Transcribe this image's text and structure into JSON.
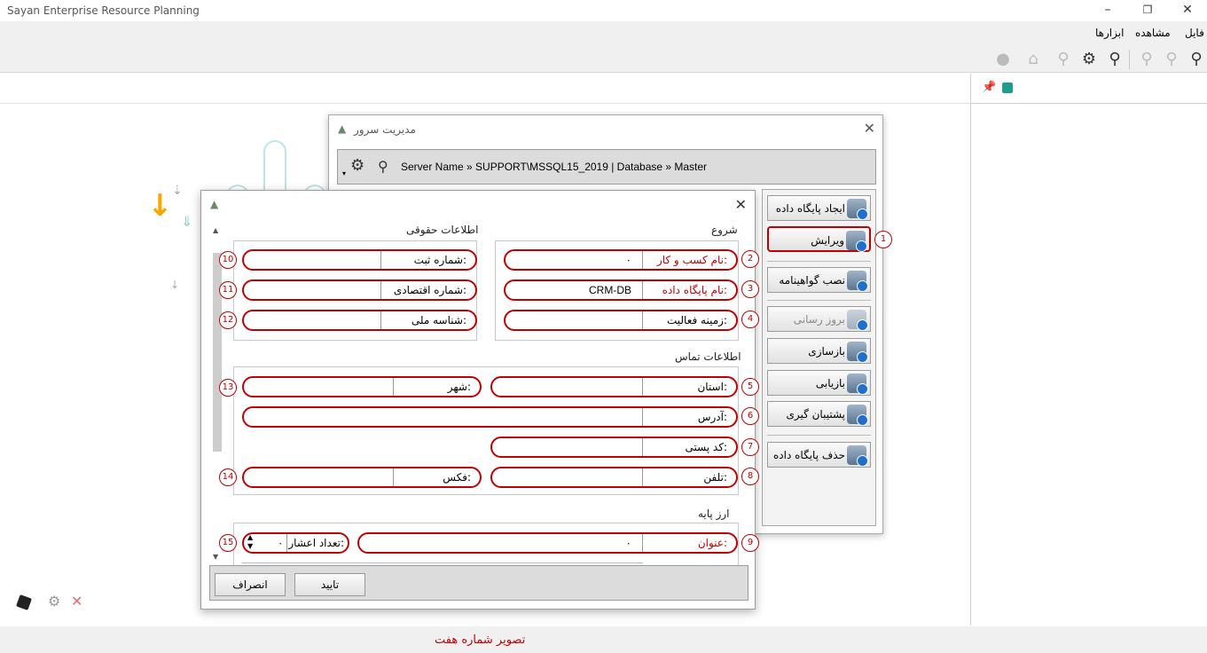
{
  "window": {
    "title": "Sayan Enterprise Resource Planning",
    "minimize_icon": "minimize-icon",
    "restore_icon": "restore-icon",
    "close_icon": "close-icon"
  },
  "menu": {
    "file": "فایل",
    "view": "مشاهده",
    "tools": "ابزارها"
  },
  "server_window": {
    "title": "مدیریت سرور",
    "connection": "Server Name » SUPPORT\\MSSQL15_2019 | Database » Master",
    "buttons": [
      {
        "label": "ایجاد پایگاه داده",
        "badge": ""
      },
      {
        "label": "ویرایش",
        "badge": "1"
      },
      {
        "label": "نصب گواهینامه",
        "badge": ""
      },
      {
        "label": "بروز رسانی",
        "badge": ""
      },
      {
        "label": "بازسازی",
        "badge": ""
      },
      {
        "label": "بازیابی",
        "badge": ""
      },
      {
        "label": "پشتیبان گیری",
        "badge": ""
      },
      {
        "label": "حذف پایگاه داده",
        "badge": ""
      }
    ]
  },
  "dialog": {
    "sections": {
      "start": "شروع",
      "legal": "اطلاعات حقوقی",
      "contact": "اطلاعات تماس",
      "base_currency": "ارز پایه"
    },
    "fields": {
      "business_name": {
        "label": "نام کسب و کار:",
        "value": "٠",
        "badge": "2"
      },
      "database_name": {
        "label": "نام پایگاه داده:",
        "value": "CRM-DB",
        "badge": "3"
      },
      "activity_field": {
        "label": "زمینه فعالیت:",
        "value": "",
        "badge": "4"
      },
      "province": {
        "label": "استان:",
        "value": "",
        "badge": "5"
      },
      "address": {
        "label": "آدرس:",
        "value": "",
        "badge": "6"
      },
      "postal_code": {
        "label": "کد پستی:",
        "value": "",
        "badge": "7"
      },
      "phone": {
        "label": "تلفن:",
        "value": "",
        "badge": "8"
      },
      "currency_title": {
        "label": "عنوان:",
        "value": "٠",
        "badge": "9"
      },
      "registration_number": {
        "label": "شماره ثبت:",
        "value": "",
        "badge": "10"
      },
      "economic_number": {
        "label": "شماره اقتصادی:",
        "value": "",
        "badge": "11"
      },
      "national_id": {
        "label": "شناسه ملی:",
        "value": "",
        "badge": "12"
      },
      "city": {
        "label": "شهر:",
        "value": "",
        "badge": "13"
      },
      "fax": {
        "label": "فکس:",
        "value": "",
        "badge": "14"
      },
      "decimals": {
        "label": "تعداد اعشار:",
        "value": "٠",
        "badge": "15"
      }
    },
    "ok_label": "تایید",
    "cancel_label": "انصراف"
  },
  "caption": "تصویر شماره هفت",
  "colors": {
    "annotation": "#c00000",
    "accent_arrow": "#f5a800",
    "button_badge": "#1f6fd1"
  }
}
